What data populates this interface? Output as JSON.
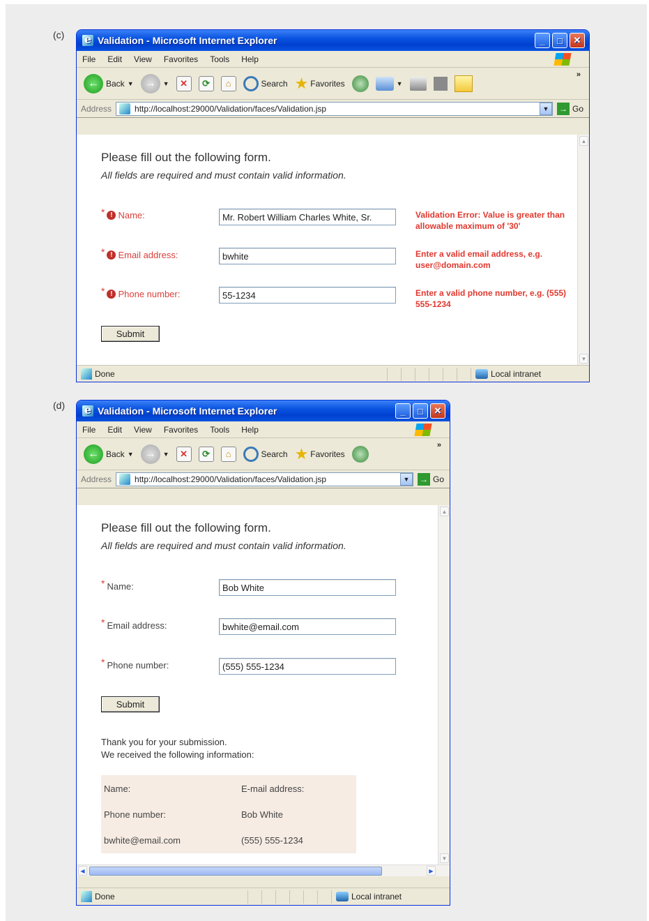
{
  "panels": [
    {
      "label": "(c)"
    },
    {
      "label": "(d)"
    }
  ],
  "browser": {
    "title": "Validation - Microsoft Internet Explorer",
    "menu": [
      "File",
      "Edit",
      "View",
      "Favorites",
      "Tools",
      "Help"
    ],
    "toolbar": {
      "back": "Back",
      "search": "Search",
      "favorites": "Favorites"
    },
    "address_label": "Address",
    "url": "http://localhost:29000/Validation/faces/Validation.jsp",
    "go": "Go",
    "status_done": "Done",
    "zone": "Local intranet"
  },
  "form": {
    "heading": "Please fill out the following form.",
    "subheading": "All fields are required and must contain valid information.",
    "labels": {
      "name": "Name:",
      "email": "Email address:",
      "phone": "Phone number:"
    },
    "submit": "Submit"
  },
  "panel_c": {
    "name_value": "Mr. Robert William Charles White, Sr.",
    "email_value": "bwhite",
    "phone_value": "55-1234",
    "errors": {
      "name": "Validation Error: Value is greater than allowable maximum of '30'",
      "email": "Enter a valid email address, e.g. user@domain.com",
      "phone": "Enter a valid phone number, e.g. (555) 555-1234"
    }
  },
  "panel_d": {
    "name_value": "Bob White",
    "email_value": "bwhite@email.com",
    "phone_value": "(555) 555-1234",
    "thanks_line1": "Thank you for your submission.",
    "thanks_line2": "We received the following information:",
    "result_cells": [
      [
        "Name:",
        "E-mail address:"
      ],
      [
        "Phone number:",
        "Bob White"
      ],
      [
        "bwhite@email.com",
        "(555) 555-1234"
      ]
    ]
  }
}
